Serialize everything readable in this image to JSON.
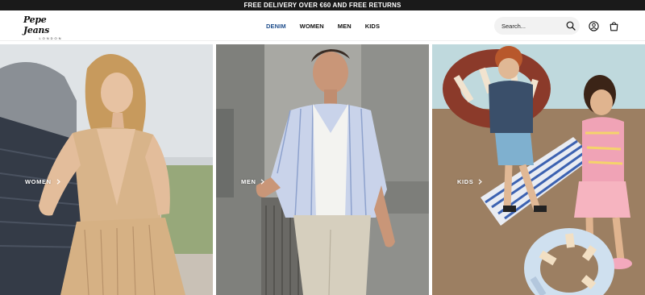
{
  "promo_bar": {
    "text": "FREE DELIVERY OVER €60 AND FREE RETURNS"
  },
  "header": {
    "logo": {
      "name": "Pepe Jeans",
      "sub": "LONDON"
    },
    "nav": [
      {
        "label": "DENIM",
        "active": true
      },
      {
        "label": "WOMEN",
        "active": false
      },
      {
        "label": "MEN",
        "active": false
      },
      {
        "label": "KIDS",
        "active": false
      }
    ],
    "search": {
      "placeholder": "Search..."
    },
    "icons": [
      "search-icon",
      "account-icon",
      "shopping-bag-icon"
    ]
  },
  "tiles": [
    {
      "label": "WOMEN",
      "icon": "chevron-right-icon"
    },
    {
      "label": "MEN",
      "icon": "chevron-right-icon"
    },
    {
      "label": "KIDS",
      "icon": "chevron-right-icon"
    }
  ],
  "colors": {
    "promo_bg": "#1a1a1a",
    "nav_active": "#1f4e8c",
    "search_bg": "#f2f2f2"
  }
}
